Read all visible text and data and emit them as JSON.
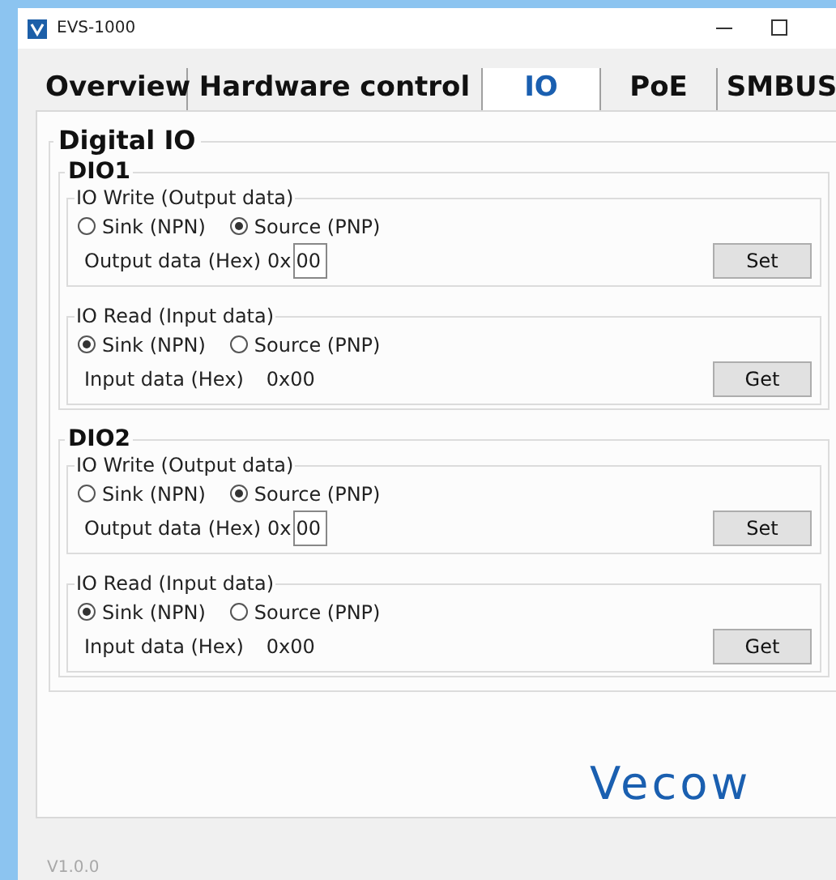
{
  "window": {
    "title": "EVS-1000"
  },
  "tabs": [
    {
      "label": "Overview",
      "selected": false
    },
    {
      "label": "Hardware control",
      "selected": false
    },
    {
      "label": "IO",
      "selected": true
    },
    {
      "label": "PoE",
      "selected": false
    },
    {
      "label": "SMBUS",
      "selected": false
    }
  ],
  "digital_io": {
    "title": "Digital IO",
    "sections": [
      {
        "title": "DIO1",
        "groups": [
          {
            "kind": "write",
            "title": "IO Write (Output data)",
            "options": [
              {
                "label": "Sink (NPN)",
                "selected": false
              },
              {
                "label": "Source (PNP)",
                "selected": true
              }
            ],
            "field_label": "Output data (Hex)",
            "prefix": "0x",
            "value": "00",
            "button": "Set"
          },
          {
            "kind": "read",
            "title": "IO Read (Input data)",
            "options": [
              {
                "label": "Sink (NPN)",
                "selected": true
              },
              {
                "label": "Source (PNP)",
                "selected": false
              }
            ],
            "field_label": "Input data (Hex)",
            "value": "0x00",
            "button": "Get"
          }
        ]
      },
      {
        "title": "DIO2",
        "groups": [
          {
            "kind": "write",
            "title": "IO Write (Output data)",
            "options": [
              {
                "label": "Sink (NPN)",
                "selected": false
              },
              {
                "label": "Source (PNP)",
                "selected": true
              }
            ],
            "field_label": "Output data (Hex)",
            "prefix": "0x",
            "value": "00",
            "button": "Set"
          },
          {
            "kind": "read",
            "title": "IO Read (Input data)",
            "options": [
              {
                "label": "Sink (NPN)",
                "selected": true
              },
              {
                "label": "Source (PNP)",
                "selected": false
              }
            ],
            "field_label": "Input data (Hex)",
            "value": "0x00",
            "button": "Get"
          }
        ]
      }
    ]
  },
  "logo": "Vecow",
  "version": "V1.0.0"
}
